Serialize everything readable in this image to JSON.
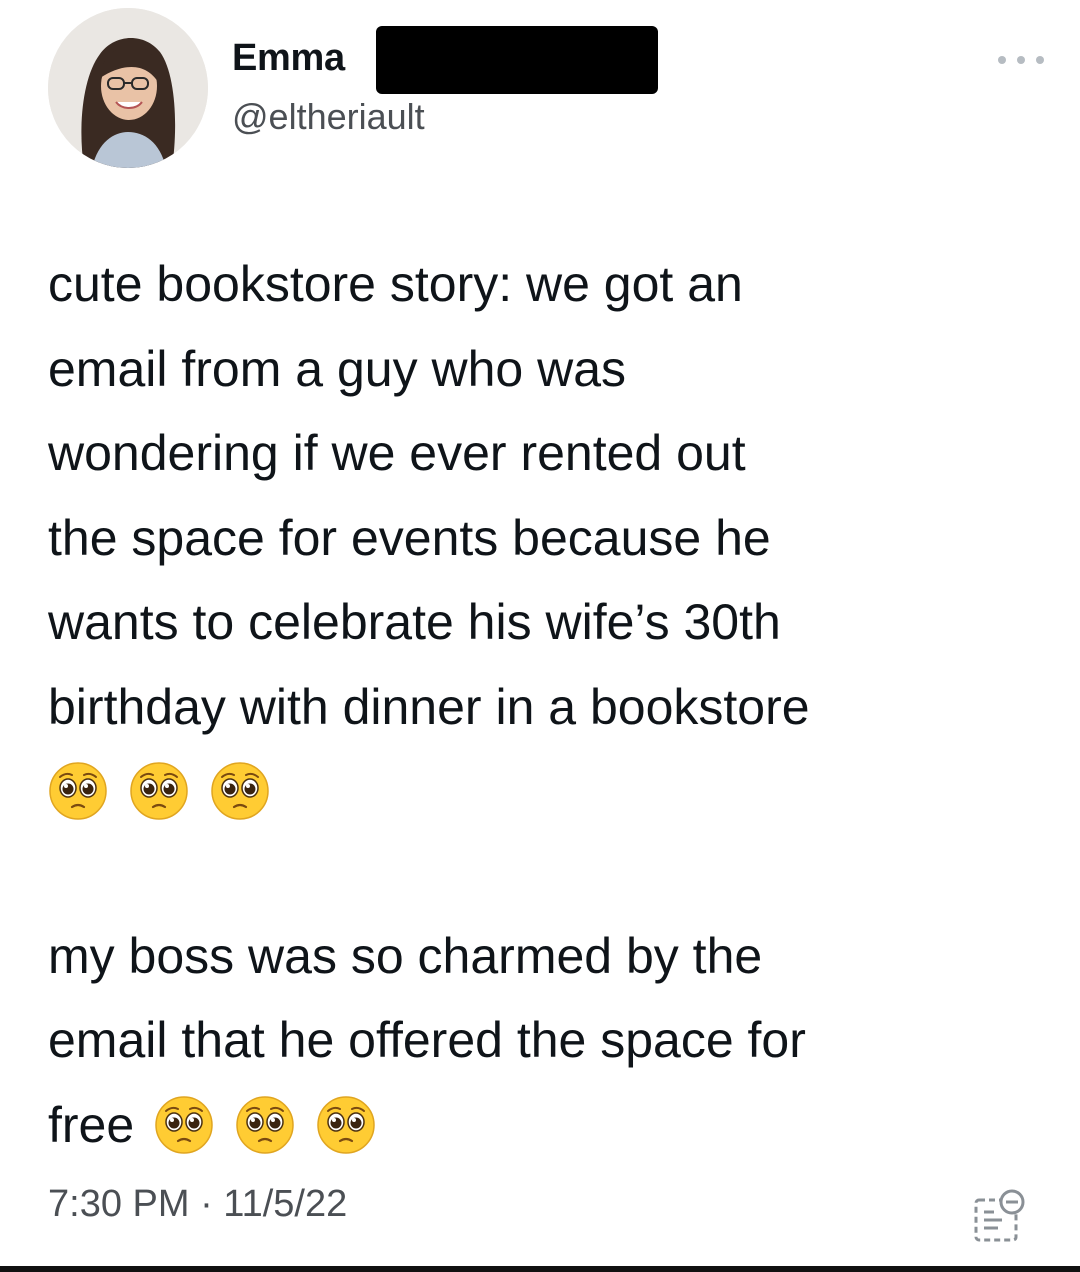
{
  "tweet": {
    "author": {
      "display_name": "Emma",
      "handle": "@eltheriault"
    },
    "more_icon": "more-horizontal-icon",
    "body": {
      "paragraph1": [
        "cute bookstore story: we got an",
        "email from a guy who was",
        "wondering if we ever rented out",
        "the space for events because he",
        "wants to celebrate his wife’s 30th",
        "birthday with dinner in a bookstore"
      ],
      "paragraph1_emojis": [
        "pleading-face-emoji",
        "pleading-face-emoji",
        "pleading-face-emoji"
      ],
      "paragraph2": [
        "my boss was so charmed by the",
        "email that he offered the space for",
        "free"
      ],
      "paragraph2_emojis": [
        "pleading-face-emoji",
        "pleading-face-emoji",
        "pleading-face-emoji"
      ]
    },
    "timestamp": "7:30 PM · 11/5/22",
    "source_icon": "scan-icon",
    "colors": {
      "text": "#0f1419",
      "secondary_text": "#4b4f54",
      "redaction": "#000000",
      "emoji_face": "#ffcc33"
    }
  }
}
